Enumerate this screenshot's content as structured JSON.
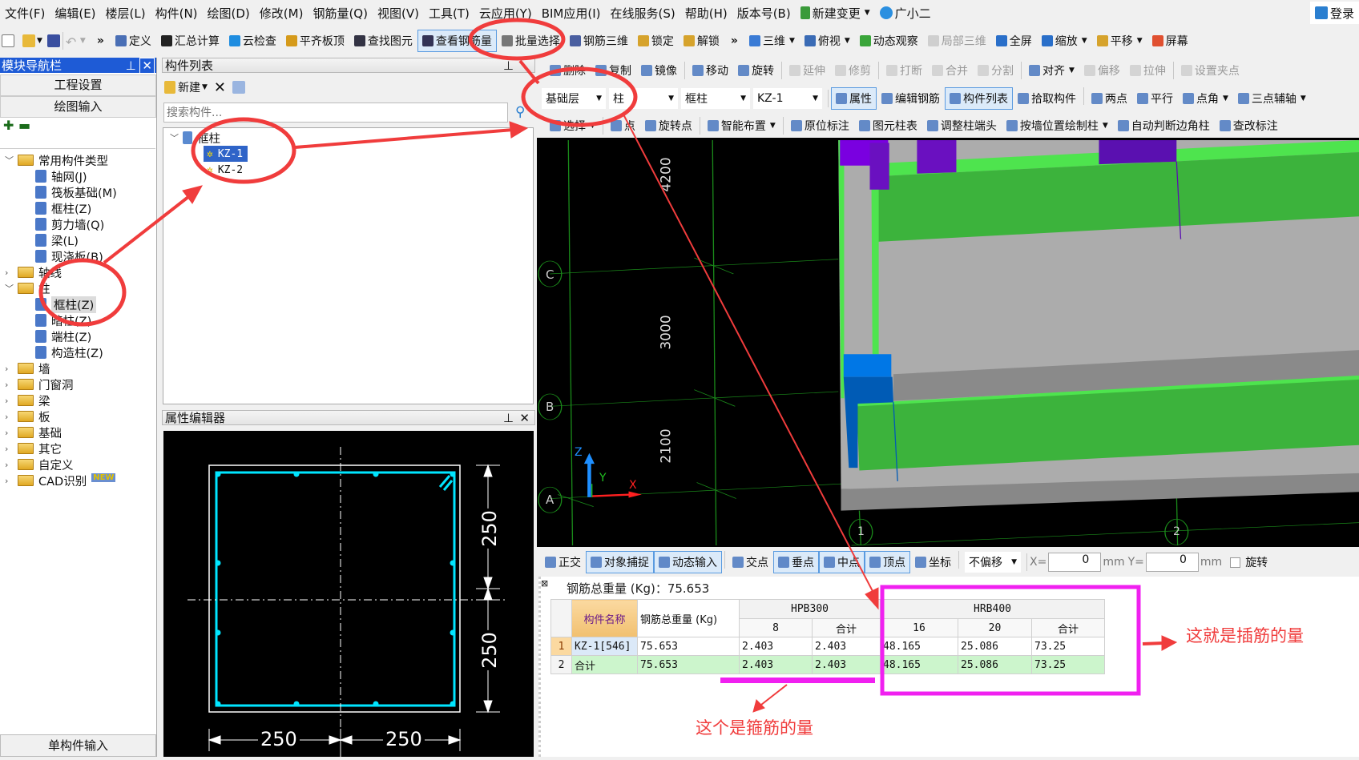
{
  "menu": {
    "items": [
      "文件(F)",
      "编辑(E)",
      "楼层(L)",
      "构件(N)",
      "绘图(D)",
      "修改(M)",
      "钢筋量(Q)",
      "视图(V)",
      "工具(T)",
      "云应用(Y)",
      "BIM应用(I)",
      "在线服务(S)",
      "帮助(H)",
      "版本号(B)"
    ],
    "new_change": "新建变更",
    "assistant": "广小二",
    "login": "登录"
  },
  "main_toolbar": {
    "more": "»",
    "items": [
      {
        "label": "定义",
        "icon": "define-icon",
        "color": "#4a6fb5"
      },
      {
        "label": "汇总计算",
        "icon": "sigma-icon",
        "color": "#222"
      },
      {
        "label": "云检查",
        "icon": "cloud-check-icon",
        "color": "#1f8de0"
      },
      {
        "label": "平齐板顶",
        "icon": "align-slab-icon",
        "color": "#d59a1a"
      },
      {
        "label": "查找图元",
        "icon": "binoculars-icon",
        "color": "#334"
      },
      {
        "label": "查看钢筋量",
        "icon": "glasses-icon",
        "color": "#335",
        "active": true
      },
      {
        "label": "批量选择",
        "icon": "batch-select-icon",
        "color": "#777"
      },
      {
        "label": "钢筋三维",
        "icon": "rebar-3d-icon",
        "color": "#4a5fa0"
      },
      {
        "label": "锁定",
        "icon": "lock-icon",
        "color": "#d6a32c"
      },
      {
        "label": "解锁",
        "icon": "unlock-icon",
        "color": "#d6a32c"
      }
    ],
    "view_items": [
      {
        "label": "三维",
        "icon": "cube-icon",
        "color": "#3a7bd5",
        "dropdown": true
      },
      {
        "label": "俯视",
        "icon": "top-view-icon",
        "color": "#3a6bb5",
        "dropdown": true
      },
      {
        "label": "动态观察",
        "icon": "orbit-icon",
        "color": "#3aa53a"
      },
      {
        "label": "局部三维",
        "icon": "partial-3d-icon",
        "color": "#bbb",
        "disabled": true
      },
      {
        "label": "全屏",
        "icon": "fullscreen-icon",
        "color": "#2a6fc9"
      },
      {
        "label": "缩放",
        "icon": "zoom-icon",
        "color": "#2a6fc9",
        "dropdown": true
      },
      {
        "label": "平移",
        "icon": "pan-hand-icon",
        "color": "#d6a32c",
        "dropdown": true
      },
      {
        "label": "屏幕",
        "icon": "screen-rotate-icon",
        "color": "#e05030"
      }
    ]
  },
  "nav_panel": {
    "title": "模块导航栏",
    "btn_project": "工程设置",
    "btn_draw": "绘图输入",
    "footer": "单构件输入",
    "tree": [
      {
        "label": "常用构件类型",
        "level": 0,
        "folder": true,
        "expanded": true
      },
      {
        "label": "轴网(J)",
        "level": 1,
        "icon": "grid-icon"
      },
      {
        "label": "筏板基础(M)",
        "level": 1,
        "icon": "raft-icon"
      },
      {
        "label": "框柱(Z)",
        "level": 1,
        "icon": "column-icon"
      },
      {
        "label": "剪力墙(Q)",
        "level": 1,
        "icon": "shear-wall-icon"
      },
      {
        "label": "梁(L)",
        "level": 1,
        "icon": "beam-icon"
      },
      {
        "label": "现浇板(B)",
        "level": 1,
        "icon": "slab-icon"
      },
      {
        "label": "轴线",
        "level": 0,
        "folder": true
      },
      {
        "label": "柱",
        "level": 0,
        "folder": true,
        "expanded": true
      },
      {
        "label": "框柱(Z)",
        "level": 1,
        "icon": "column-icon",
        "selected": true
      },
      {
        "label": "暗柱(Z)",
        "level": 1,
        "icon": "column-icon"
      },
      {
        "label": "端柱(Z)",
        "level": 1,
        "icon": "column-icon"
      },
      {
        "label": "构造柱(Z)",
        "level": 1,
        "icon": "constructional-column-icon"
      },
      {
        "label": "墙",
        "level": 0,
        "folder": true
      },
      {
        "label": "门窗洞",
        "level": 0,
        "folder": true
      },
      {
        "label": "梁",
        "level": 0,
        "folder": true
      },
      {
        "label": "板",
        "level": 0,
        "folder": true
      },
      {
        "label": "基础",
        "level": 0,
        "folder": true
      },
      {
        "label": "其它",
        "level": 0,
        "folder": true
      },
      {
        "label": "自定义",
        "level": 0,
        "folder": true
      },
      {
        "label": "CAD识别",
        "level": 0,
        "folder": true,
        "badge": "NEW"
      }
    ]
  },
  "component_list": {
    "title": "构件列表",
    "new_label": "新建",
    "search_placeholder": "搜索构件...",
    "group": "框柱",
    "items": [
      {
        "label": "KZ-1",
        "selected": true
      },
      {
        "label": "KZ-2"
      }
    ]
  },
  "property_editor": {
    "title": "属性编辑器",
    "dims": {
      "right_top": "250",
      "right_bottom": "250",
      "bottom_left": "250",
      "bottom_right": "250"
    }
  },
  "edit_toolbar": {
    "items": [
      {
        "label": "删除",
        "icon": "delete-icon"
      },
      {
        "label": "复制",
        "icon": "copy-icon"
      },
      {
        "label": "镜像",
        "icon": "mirror-icon",
        "sep": true
      },
      {
        "label": "移动",
        "icon": "move-icon"
      },
      {
        "label": "旋转",
        "icon": "rotate-icon",
        "sep": true
      },
      {
        "label": "延伸",
        "icon": "extend-icon",
        "disabled": true
      },
      {
        "label": "修剪",
        "icon": "trim-icon",
        "disabled": true,
        "sep": true
      },
      {
        "label": "打断",
        "icon": "break-icon",
        "disabled": true
      },
      {
        "label": "合并",
        "icon": "merge-icon",
        "disabled": true
      },
      {
        "label": "分割",
        "icon": "split-icon",
        "disabled": true,
        "sep": true
      },
      {
        "label": "对齐",
        "icon": "align-icon",
        "dropdown": true
      },
      {
        "label": "偏移",
        "icon": "offset-icon",
        "disabled": true
      },
      {
        "label": "拉伸",
        "icon": "stretch-icon",
        "disabled": true,
        "sep": true
      },
      {
        "label": "设置夹点",
        "icon": "grip-icon",
        "disabled": true
      }
    ]
  },
  "selector_toolbar": {
    "floor": "基础层",
    "category": "柱",
    "type": "框柱",
    "component": "KZ-1",
    "items": [
      {
        "label": "属性",
        "icon": "properties-icon",
        "active": true
      },
      {
        "label": "编辑钢筋",
        "icon": "edit-rebar-icon"
      },
      {
        "label": "构件列表",
        "icon": "component-list-icon",
        "active": true
      },
      {
        "label": "拾取构件",
        "icon": "pick-icon",
        "sep": true
      },
      {
        "label": "两点",
        "icon": "two-point-axis-icon"
      },
      {
        "label": "平行",
        "icon": "parallel-axis-icon"
      },
      {
        "label": "点角",
        "icon": "point-angle-icon",
        "dropdown": true
      },
      {
        "label": "三点辅轴",
        "icon": "three-point-axis-icon",
        "dropdown": true
      }
    ]
  },
  "draw_toolbar": {
    "items": [
      {
        "label": "选择",
        "icon": "select-icon",
        "dropdown": true,
        "sep": true
      },
      {
        "label": "点",
        "icon": "point-icon"
      },
      {
        "label": "旋转点",
        "icon": "rotate-point-icon",
        "sep": true
      },
      {
        "label": "智能布置",
        "icon": "smart-layout-icon",
        "dropdown": true,
        "sep": true
      },
      {
        "label": "原位标注",
        "icon": "in-place-label-icon"
      },
      {
        "label": "图元柱表",
        "icon": "column-table-icon"
      },
      {
        "label": "调整柱端头",
        "icon": "adjust-column-end-icon"
      },
      {
        "label": "按墙位置绘制柱",
        "icon": "draw-by-wall-icon",
        "dropdown": true
      },
      {
        "label": "自动判断边角柱",
        "icon": "auto-corner-column-icon"
      },
      {
        "label": "查改标注",
        "icon": "edit-label-icon"
      }
    ]
  },
  "viewport": {
    "dims": [
      "4200",
      "3000",
      "2100"
    ],
    "axis_labels": {
      "c": "C",
      "b": "B",
      "a": "A",
      "one": "1",
      "two": "2"
    },
    "coord_axes": {
      "z": "Z",
      "y": "Y",
      "x": "X"
    }
  },
  "snap_toolbar": {
    "items": [
      {
        "label": "正交",
        "icon": "ortho-icon"
      },
      {
        "label": "对象捕捉",
        "icon": "object-snap-icon",
        "active": true
      },
      {
        "label": "动态输入",
        "icon": "dynamic-input-icon",
        "active": true,
        "sep": true
      },
      {
        "label": "交点",
        "icon": "intersection-icon"
      },
      {
        "label": "垂点",
        "icon": "perpendicular-icon",
        "active": true
      },
      {
        "label": "中点",
        "icon": "midpoint-icon",
        "active": true
      },
      {
        "label": "顶点",
        "icon": "vertex-icon",
        "active": true
      },
      {
        "label": "坐标",
        "icon": "coordinate-icon",
        "sep": true
      }
    ],
    "offset_mode": "不偏移",
    "x_label": "X=",
    "x_value": "0",
    "x_unit": "mm",
    "y_label": "Y=",
    "y_value": "0",
    "y_unit": "mm",
    "rotate_label": "旋转",
    "rotate_checked": false
  },
  "results": {
    "total_label": "钢筋总重量 (Kg)：75.653",
    "headers": {
      "name": "构件名称",
      "total": "钢筋总重量 (Kg)",
      "grade1": "HPB300",
      "grade2": "HRB400",
      "g1_cols": [
        "8",
        "合计"
      ],
      "g2_cols": [
        "16",
        "20",
        "合计"
      ]
    },
    "rows": [
      {
        "num": "1",
        "name": "KZ-1[546]",
        "total": "75.653",
        "g1": [
          "2.403",
          "2.403"
        ],
        "g2": [
          "48.165",
          "25.086",
          "73.25"
        ]
      },
      {
        "num": "2",
        "name": "合计",
        "total": "75.653",
        "g1": [
          "2.403",
          "2.403"
        ],
        "g2": [
          "48.165",
          "25.086",
          "73.25"
        ]
      }
    ]
  },
  "annotations": {
    "dowel_note": "这就是插筋的量",
    "stirrup_note": "这个是箍筋的量",
    "red": "#f03c3c",
    "magenta": "#f020f0"
  }
}
